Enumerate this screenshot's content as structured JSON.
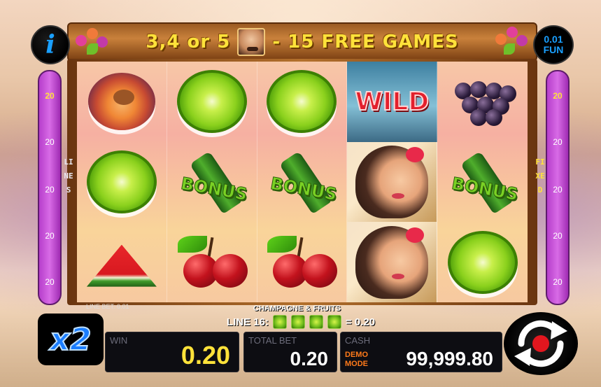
{
  "banner": {
    "text_left": "3,4 or 5",
    "text_right": "- 15 FREE GAMES"
  },
  "info_button": {
    "label": "i"
  },
  "fun_box": {
    "value": "0.01",
    "currency": "FUN"
  },
  "side_lines": {
    "left": [
      "20",
      "20",
      "20",
      "20",
      "20"
    ],
    "right": [
      "20",
      "20",
      "20",
      "20",
      "20"
    ]
  },
  "vertical_labels": {
    "left": "LINES",
    "right": "FIXED"
  },
  "reels": [
    [
      "plum",
      "lime",
      "lime",
      "wild",
      "grapes"
    ],
    [
      "lime",
      "bonus",
      "bonus",
      "girl",
      "bonus"
    ],
    [
      "watermelon",
      "cherries",
      "cherries",
      "girl",
      "lime"
    ]
  ],
  "symbol_labels": {
    "bonus": "BONUS",
    "wild": "WILD"
  },
  "game_name": "CHAMPAGNE & FRUITS",
  "line_bet": "LINE BET: 0.01",
  "line_win": {
    "prefix": "LINE 16:",
    "suffix": "= 0.20",
    "count": 4
  },
  "multiplier": "x2",
  "panels": {
    "win": {
      "label": "WIN",
      "value": "0.20"
    },
    "total_bet": {
      "label": "TOTAL BET",
      "value": "0.20"
    },
    "cash": {
      "label": "CASH",
      "value": "99,999.80",
      "mode_line1": "DEMO",
      "mode_line2": "MODE"
    }
  },
  "colors": {
    "accent_yellow": "#ffe23a",
    "brand_blue": "#1a7dff",
    "purple_panel": "#c655d9"
  }
}
